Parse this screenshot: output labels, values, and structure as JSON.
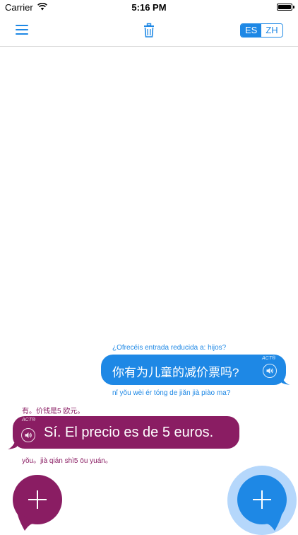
{
  "status_bar": {
    "carrier": "Carrier",
    "time": "5:16 PM",
    "icons": [
      "wifi-icon",
      "battery-icon"
    ]
  },
  "nav_bar": {
    "menu_icon": "hamburger-menu-icon",
    "trash_icon": "trash-icon",
    "language_toggle": {
      "left": "ES",
      "right": "ZH",
      "selected": "ES"
    }
  },
  "conversation": {
    "message_1": {
      "source_caption": "¿Ofrecéis entrada reducida a: hijos?",
      "translation": "你有为儿童的减价票吗?",
      "pinyin": "nǐ yǒu wèi ér tóng de jiǎn jià piào ma?",
      "act_label": "ACT®",
      "speaker_icon": "speaker-icon"
    },
    "message_2": {
      "source_caption": "有。价钱是5 欧元。",
      "translation": "Sí. El precio es de 5 euros.",
      "pinyin": "yǒu。jià qián shì5 ōu yuán。",
      "act_label": "ACT®",
      "speaker_icon": "speaker-icon"
    }
  },
  "actions": {
    "left_button_icon": "plus-icon",
    "right_button_icon": "plus-icon"
  },
  "colors": {
    "blue": "#1e88e5",
    "purple": "#8a1d63",
    "halo": "#b5d7fb"
  }
}
